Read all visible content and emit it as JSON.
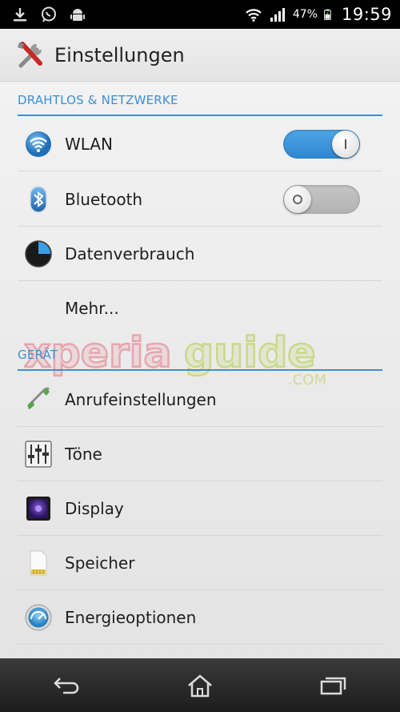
{
  "statusbar": {
    "battery_percent": "47%",
    "time": "19:59"
  },
  "actionbar": {
    "title": "Einstellungen"
  },
  "sections": [
    {
      "header": "DRAHTLOS & NETZWERKE",
      "items": [
        {
          "label": "WLAN",
          "icon": "wifi-icon",
          "toggle": "on"
        },
        {
          "label": "Bluetooth",
          "icon": "bluetooth-icon",
          "toggle": "off"
        },
        {
          "label": "Datenverbrauch",
          "icon": "data-usage-icon"
        },
        {
          "label": "Mehr..."
        }
      ]
    },
    {
      "header": "GERÄT",
      "items": [
        {
          "label": "Anrufeinstellungen",
          "icon": "phone-icon"
        },
        {
          "label": "Töne",
          "icon": "sliders-icon"
        },
        {
          "label": "Display",
          "icon": "display-icon"
        },
        {
          "label": "Speicher",
          "icon": "sd-card-icon"
        },
        {
          "label": "Energieoptionen",
          "icon": "power-gauge-icon"
        }
      ]
    }
  ],
  "colors": {
    "accent": "#3d8fd6",
    "toggle_on": "#3a94da",
    "toggle_off": "#bcbcbc"
  }
}
